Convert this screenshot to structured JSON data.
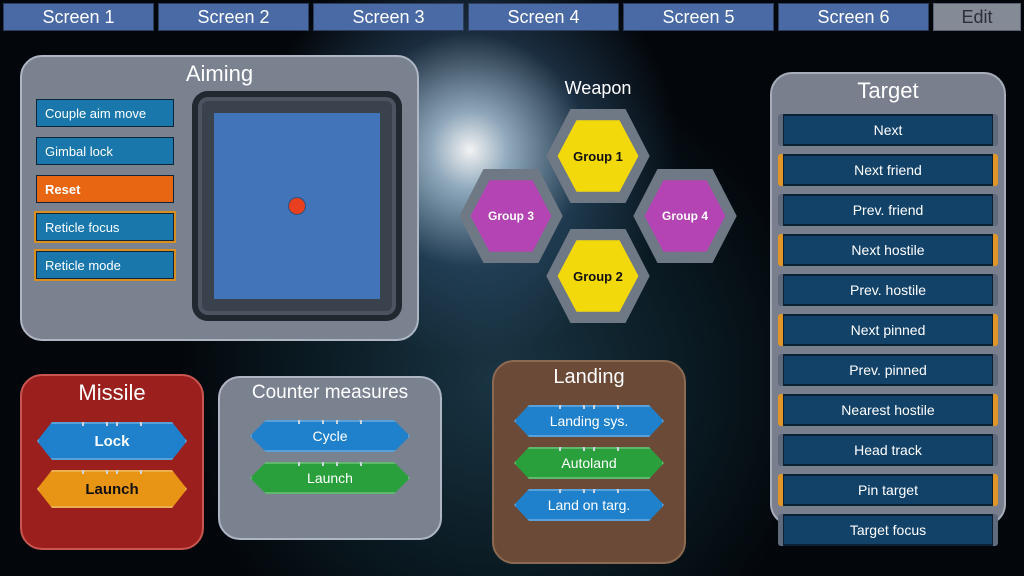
{
  "tabs": [
    "Screen 1",
    "Screen 2",
    "Screen 3",
    "Screen 4",
    "Screen 5",
    "Screen 6"
  ],
  "edit_label": "Edit",
  "aiming": {
    "title": "Aiming",
    "buttons": [
      {
        "label": "Couple aim move",
        "style": "blue",
        "framed": false
      },
      {
        "label": "Gimbal lock",
        "style": "blue",
        "framed": false
      },
      {
        "label": "Reset",
        "style": "orange",
        "framed": false
      },
      {
        "label": "Reticle focus",
        "style": "blue",
        "framed": true
      },
      {
        "label": "Reticle mode",
        "style": "blue",
        "framed": true
      }
    ]
  },
  "missile": {
    "title": "Missile",
    "lock": "Lock",
    "launch": "Launch"
  },
  "cm": {
    "title": "Counter measures",
    "cycle": "Cycle",
    "launch": "Launch"
  },
  "landing": {
    "title": "Landing",
    "sys": "Landing sys.",
    "auto": "Autoland",
    "targ": "Land on targ."
  },
  "weapon": {
    "title": "Weapon",
    "g1": "Group 1",
    "g2": "Group 2",
    "g3": "Group 3",
    "g4": "Group 4"
  },
  "target": {
    "title": "Target",
    "items": [
      {
        "label": "Next",
        "framed": false
      },
      {
        "label": "Next friend",
        "framed": true
      },
      {
        "label": "Prev. friend",
        "framed": false
      },
      {
        "label": "Next hostile",
        "framed": true
      },
      {
        "label": "Prev. hostile",
        "framed": false
      },
      {
        "label": "Next pinned",
        "framed": true
      },
      {
        "label": "Prev. pinned",
        "framed": false
      },
      {
        "label": "Nearest hostile",
        "framed": true
      },
      {
        "label": "Head track",
        "framed": false
      },
      {
        "label": "Pin target",
        "framed": true
      },
      {
        "label": "Target focus",
        "framed": false
      }
    ]
  }
}
